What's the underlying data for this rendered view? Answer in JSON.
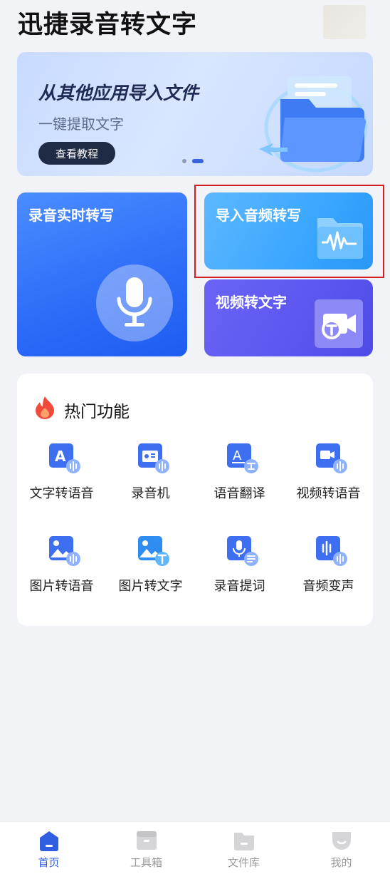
{
  "header": {
    "title": "迅捷录音转文字"
  },
  "banner": {
    "title": "从其他应用导入文件",
    "subtitle": "一键提取文字",
    "button_label": "查看教程",
    "page_count": 2,
    "active_page": 2
  },
  "cards": {
    "record": {
      "label": "录音实时转写",
      "icon": "microphone-icon"
    },
    "import": {
      "label": "导入音频转写",
      "icon": "audio-folder-icon"
    },
    "video": {
      "label": "视频转文字",
      "icon": "video-text-icon"
    }
  },
  "hot": {
    "title": "热门功能",
    "icon": "fire-icon",
    "items": [
      {
        "label": "文字转语音",
        "icon": "text-to-speech-icon"
      },
      {
        "label": "录音机",
        "icon": "recorder-icon"
      },
      {
        "label": "语音翻译",
        "icon": "voice-translate-icon"
      },
      {
        "label": "视频转语音",
        "icon": "video-to-speech-icon"
      },
      {
        "label": "图片转语音",
        "icon": "image-to-speech-icon"
      },
      {
        "label": "图片转文字",
        "icon": "image-to-text-icon"
      },
      {
        "label": "录音提词",
        "icon": "teleprompter-icon"
      },
      {
        "label": "音频变声",
        "icon": "voice-changer-icon"
      }
    ]
  },
  "tabbar": {
    "active": "首页",
    "items": [
      {
        "label": "首页",
        "icon": "home-icon"
      },
      {
        "label": "工具箱",
        "icon": "toolbox-icon"
      },
      {
        "label": "文件库",
        "icon": "folder-icon"
      },
      {
        "label": "我的",
        "icon": "profile-icon"
      }
    ]
  },
  "colors": {
    "accent": "#2f5fe0",
    "highlight": "#d21f1f"
  }
}
